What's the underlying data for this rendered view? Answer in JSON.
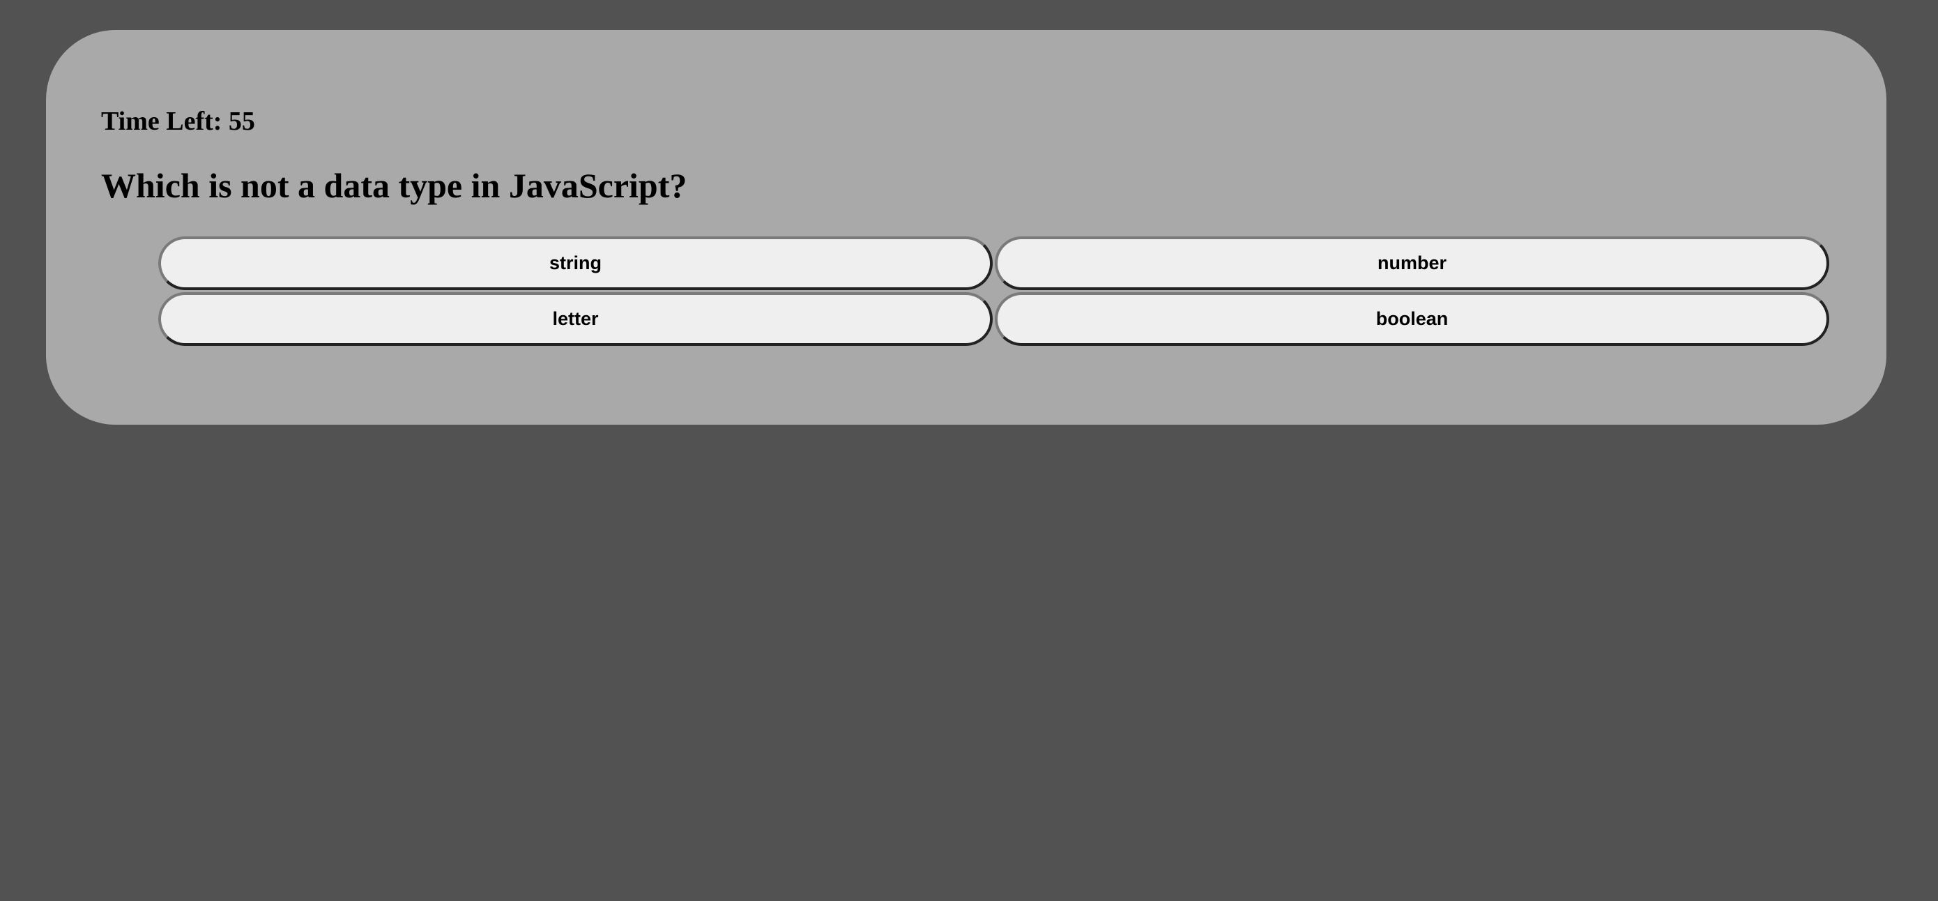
{
  "quiz": {
    "timer_label": "Time Left: 55",
    "question": "Which is not a data type in JavaScript?",
    "answers": [
      "string",
      "number",
      "letter",
      "boolean"
    ]
  },
  "colors": {
    "page_bg": "#525252",
    "card_bg": "#a9a9a9",
    "button_bg": "#efefef"
  }
}
